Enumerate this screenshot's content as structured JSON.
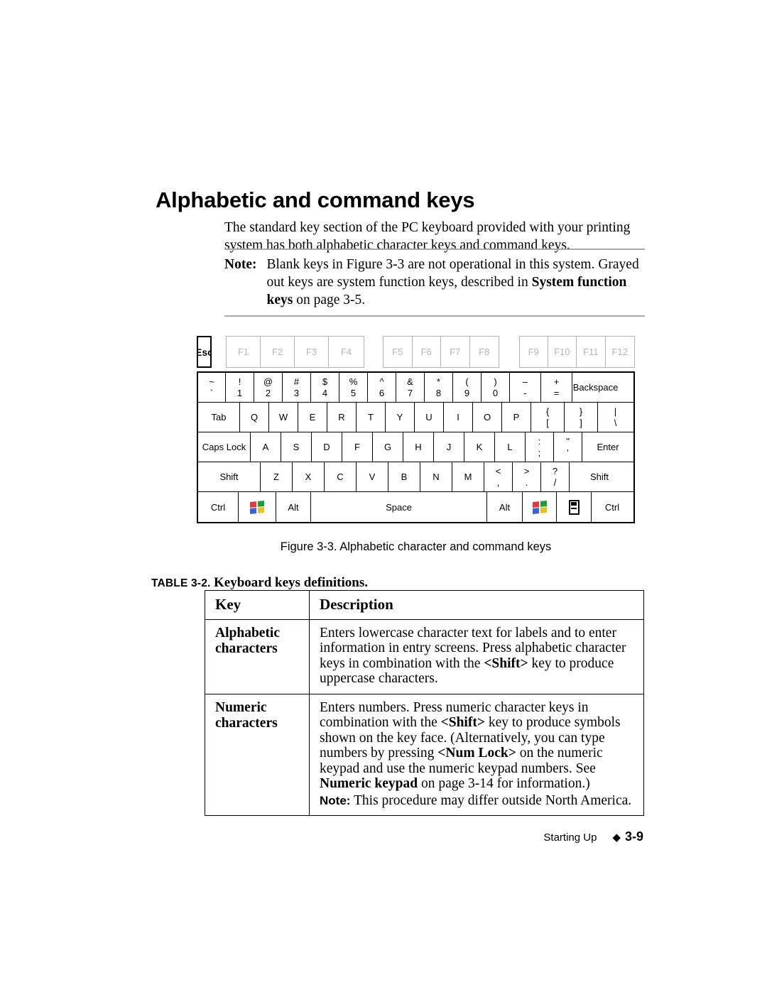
{
  "heading": "Alphabetic and command keys",
  "intro": "The standard key section of the PC keyboard provided with your printing system has both alphabetic character keys and command keys.",
  "note": {
    "label": "Note:",
    "line1": "Blank keys in Figure 3-3 are not operational in this system.",
    "line2_a": "Grayed out keys are system function keys, described in ",
    "line2_bold": "System function keys",
    "line2_b": " on page 3-5."
  },
  "keyboard": {
    "esc": "Esc",
    "fn_group_1": [
      "F1",
      "F2",
      "F3",
      "F4"
    ],
    "fn_group_2": [
      "F5",
      "F6",
      "F7",
      "F8"
    ],
    "fn_group_3": [
      "F9",
      "F10",
      "F11",
      "F12"
    ],
    "row_number": [
      {
        "upper": "~",
        "lower": "`"
      },
      {
        "upper": "!",
        "lower": "1"
      },
      {
        "upper": "@",
        "lower": "2"
      },
      {
        "upper": "#",
        "lower": "3"
      },
      {
        "upper": "$",
        "lower": "4"
      },
      {
        "upper": "%",
        "lower": "5"
      },
      {
        "upper": "^",
        "lower": "6"
      },
      {
        "upper": "&",
        "lower": "7"
      },
      {
        "upper": "*",
        "lower": "8"
      },
      {
        "upper": "(",
        "lower": "9"
      },
      {
        "upper": ")",
        "lower": "0"
      },
      {
        "upper": "–",
        "lower": "-"
      },
      {
        "upper": "+",
        "lower": "="
      },
      {
        "label": "Backspace"
      }
    ],
    "row_tab": [
      {
        "label": "Tab"
      },
      {
        "label": "Q"
      },
      {
        "label": "W"
      },
      {
        "label": "E"
      },
      {
        "label": "R"
      },
      {
        "label": "T"
      },
      {
        "label": "Y"
      },
      {
        "label": "U"
      },
      {
        "label": "I"
      },
      {
        "label": "O"
      },
      {
        "label": "P"
      },
      {
        "upper": "{",
        "lower": "["
      },
      {
        "upper": "}",
        "lower": "]"
      },
      {
        "upper": "|",
        "lower": "\\"
      }
    ],
    "row_caps": [
      {
        "label": "Caps Lock"
      },
      {
        "label": "A"
      },
      {
        "label": "S"
      },
      {
        "label": "D"
      },
      {
        "label": "F"
      },
      {
        "label": "G"
      },
      {
        "label": "H"
      },
      {
        "label": "J"
      },
      {
        "label": "K"
      },
      {
        "label": "L"
      },
      {
        "upper": ":",
        "lower": ";"
      },
      {
        "upper": "\"",
        "lower": "'"
      },
      {
        "label": "Enter"
      }
    ],
    "row_shift": [
      {
        "label": "Shift"
      },
      {
        "label": "Z"
      },
      {
        "label": "X"
      },
      {
        "label": "C"
      },
      {
        "label": "V"
      },
      {
        "label": "B"
      },
      {
        "label": "N"
      },
      {
        "label": "M"
      },
      {
        "upper": "<",
        "lower": ","
      },
      {
        "upper": ">",
        "lower": "."
      },
      {
        "upper": "?",
        "lower": "/"
      },
      {
        "label": "Shift"
      }
    ],
    "row_bottom": [
      {
        "label": "Ctrl"
      },
      {
        "icon": "windows-logo-icon"
      },
      {
        "label": "Alt"
      },
      {
        "label": "Space"
      },
      {
        "label": "Alt"
      },
      {
        "icon": "windows-logo-icon"
      },
      {
        "icon": "menu-key-icon"
      },
      {
        "label": "Ctrl"
      }
    ]
  },
  "figure_caption": "Figure 3-3. Alphabetic character and command keys",
  "table_title": {
    "number": "TABLE 3-2.",
    "name": "Keyboard keys definitions."
  },
  "table": {
    "headers": [
      "Key",
      "Description"
    ],
    "rows": [
      {
        "key": "Alphabetic characters",
        "desc_a": "Enters lowercase character text for labels and to enter information in entry screens. Press alphabetic character keys in combination with the ",
        "desc_bold": "<Shift>",
        "desc_b": " key to produce uppercase characters."
      },
      {
        "key": "Numeric characters",
        "desc_a": "Enters numbers. Press numeric character keys in combination with the ",
        "desc_bold1": "<Shift>",
        "desc_b": " key to produce symbols shown on the key face. (Alternatively, you can type numbers by pressing ",
        "desc_bold2": "<Num Lock>",
        "desc_c": " on the numeric keypad and use the numeric keypad numbers. See ",
        "desc_bold3": "Numeric keypad",
        "desc_d": " on page 3-14 for information.)",
        "note_label": "Note:",
        "note_text": "This procedure may differ outside North America."
      }
    ]
  },
  "footer": {
    "section": "Starting Up",
    "diamond": "◆",
    "page": "3-9"
  }
}
